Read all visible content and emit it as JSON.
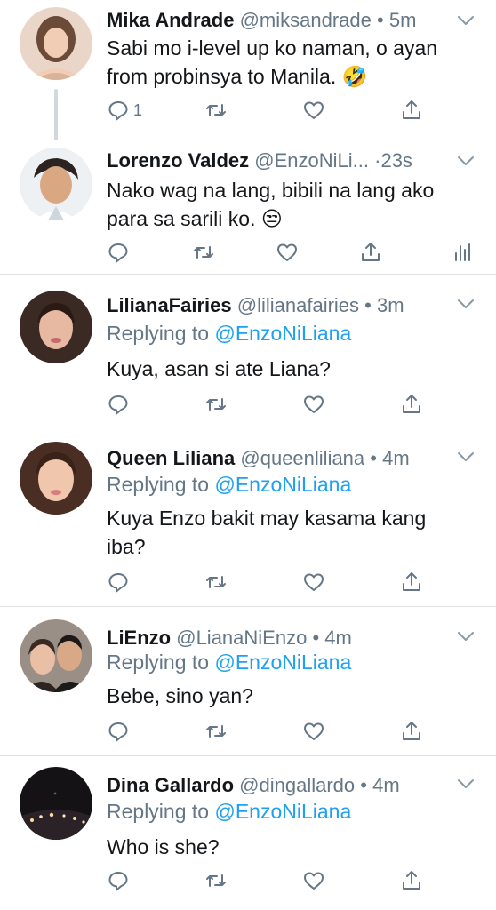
{
  "tweets": [
    {
      "name": "Mika Andrade",
      "handle": "@miksandrade",
      "dot": "•",
      "time": "5m",
      "text": "Sabi mo i-level up ko naman, o ayan from probinsya to Manila. 🤣",
      "reply_count": "1"
    },
    {
      "name": "Lorenzo Valdez",
      "handle": "@EnzoNiLi...",
      "dot": "·",
      "time": "23s",
      "text": "Nako wag na lang, bibili na lang ako para sa sarili ko. 😒"
    },
    {
      "name": "LilianaFairies",
      "handle": "@lilianafairies",
      "dot": "•",
      "time": "3m",
      "replying_label": "Replying to ",
      "replying_mention": "@EnzoNiLiana",
      "text": "Kuya, asan si ate Liana?"
    },
    {
      "name": "Queen Liliana",
      "handle": "@queenliliana",
      "dot": "•",
      "time": "4m",
      "replying_label": "Replying to ",
      "replying_mention": "@EnzoNiLiana",
      "text": "Kuya Enzo bakit may kasama kang iba?"
    },
    {
      "name": "LiEnzo",
      "handle": "@LianaNiEnzo",
      "dot": "•",
      "time": "4m",
      "replying_label": "Replying to ",
      "replying_mention": "@EnzoNiLiana",
      "text": "Bebe, sino yan?"
    },
    {
      "name": "Dina Gallardo",
      "handle": "@dingallardo",
      "dot": "•",
      "time": "4m",
      "replying_label": "Replying to ",
      "replying_mention": "@EnzoNiLiana",
      "text": "Who is she?"
    }
  ],
  "icons": {
    "reply": "reply-icon",
    "retweet": "retweet-icon",
    "like": "heart-icon",
    "share": "share-icon",
    "analytics": "analytics-icon",
    "more": "chevron-down-icon"
  },
  "colors": {
    "mention": "#1da1f2",
    "secondary_text": "#657786",
    "divider": "#dfe3e6"
  }
}
